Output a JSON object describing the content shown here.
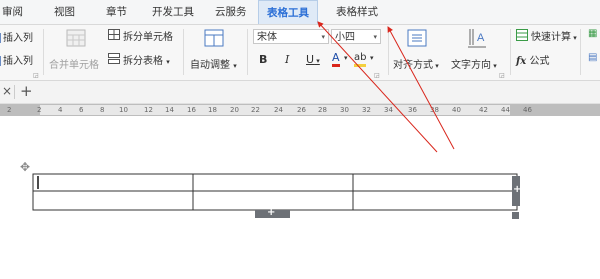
{
  "menu": {
    "items": [
      "审阅",
      "视图",
      "章节",
      "开发工具",
      "云服务",
      "表格工具",
      "表格样式"
    ],
    "active_index": 5,
    "active_color": "#2b6fd6"
  },
  "ribbon": {
    "insert_col_left": "插入列",
    "insert_col_right": "插入列",
    "merge_cells": "合并单元格",
    "split_cells": "拆分单元格",
    "split_table": "拆分表格",
    "split_table_arrow": "▾",
    "auto_fit": "自动调整",
    "auto_fit_arrow": "▾",
    "font_name": "宋体",
    "font_size": "小四",
    "bold": "B",
    "italic": "I",
    "underline": "U",
    "font_color": "A",
    "highlight": "ab",
    "align": "对齐方式",
    "text_direction": "文字方向",
    "quick_calc": "快速计算",
    "formula": "公式",
    "formula_fx": "fx"
  },
  "tabstrip": {
    "close_glyph": "×",
    "add_glyph": "+"
  },
  "ruler": {
    "numbers": [
      "2",
      "2",
      "4",
      "6",
      "8",
      "10",
      "12",
      "14",
      "16",
      "18",
      "20",
      "22",
      "24",
      "26",
      "28",
      "30",
      "32",
      "34",
      "36",
      "38",
      "40",
      "42",
      "44",
      "46"
    ]
  },
  "table": {
    "rows": 2,
    "cols": 3,
    "add_row_glyph": "+",
    "add_col_glyph": "+",
    "move_handle_glyph": "✥"
  },
  "colors": {
    "annotation_arrow": "#d9261c",
    "table_handle": "#6d7177"
  }
}
